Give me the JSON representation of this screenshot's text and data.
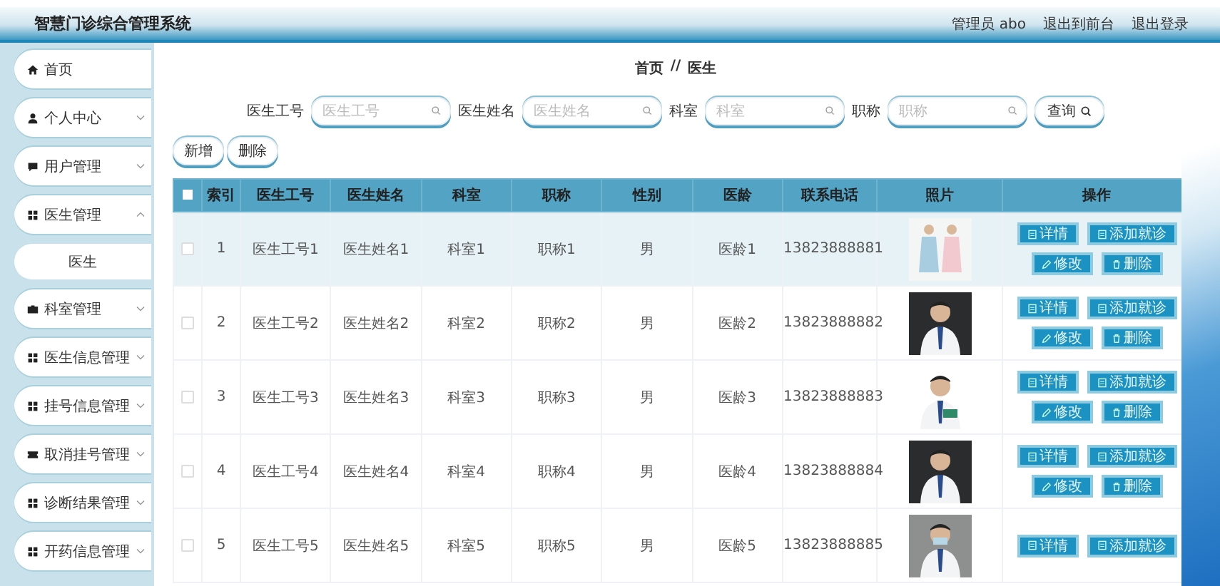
{
  "header": {
    "title": "智慧门诊综合管理系统",
    "user": "管理员 abo",
    "links": [
      "退出到前台",
      "退出登录"
    ]
  },
  "sidebar": {
    "items": [
      {
        "label": "首页"
      },
      {
        "label": "个人中心",
        "expanded": false
      },
      {
        "label": "用户管理",
        "expanded": false
      },
      {
        "label": "医生管理",
        "expanded": true,
        "children": [
          {
            "label": "医生",
            "selected": true
          }
        ]
      },
      {
        "label": "科室管理",
        "expanded": false
      },
      {
        "label": "医生信息管理",
        "expanded": false
      },
      {
        "label": "挂号信息管理",
        "expanded": false
      },
      {
        "label": "取消挂号管理",
        "expanded": false
      },
      {
        "label": "诊断结果管理",
        "expanded": false
      },
      {
        "label": "开药信息管理",
        "expanded": false
      }
    ]
  },
  "breadcrumb": [
    "首页",
    "//",
    "医生"
  ],
  "search": {
    "fields": [
      {
        "label": "医生工号",
        "placeholder": "医生工号"
      },
      {
        "label": "医生姓名",
        "placeholder": "医生姓名"
      },
      {
        "label": "科室",
        "placeholder": "科室"
      },
      {
        "label": "职称",
        "placeholder": "职称"
      }
    ],
    "button": "查询"
  },
  "actions": [
    "新增",
    "删除"
  ],
  "table": {
    "all_checked": false,
    "columns": [
      "索引",
      "医生工号",
      "医生姓名",
      "科室",
      "职称",
      "性别",
      "医龄",
      "联系电话",
      "照片",
      "操作"
    ],
    "rows": [
      {
        "cells": [
          "1",
          "医生工号1",
          "医生姓名1",
          "科室1",
          "职称1",
          "男",
          "医龄1",
          "13823888881"
        ],
        "checked": false,
        "hovered": true,
        "buttons": [
          "详情",
          "添加就诊",
          "修改",
          "删除"
        ]
      },
      {
        "cells": [
          "2",
          "医生工号2",
          "医生姓名2",
          "科室2",
          "职称2",
          "男",
          "医龄2",
          "13823888882"
        ],
        "checked": false,
        "hovered": false,
        "buttons": [
          "详情",
          "添加就诊",
          "修改",
          "删除"
        ]
      },
      {
        "cells": [
          "3",
          "医生工号3",
          "医生姓名3",
          "科室3",
          "职称3",
          "男",
          "医龄3",
          "13823888883"
        ],
        "checked": false,
        "hovered": false,
        "buttons": [
          "详情",
          "添加就诊",
          "修改",
          "删除"
        ]
      },
      {
        "cells": [
          "4",
          "医生工号4",
          "医生姓名4",
          "科室4",
          "职称4",
          "男",
          "医龄4",
          "13823888884"
        ],
        "checked": false,
        "hovered": false,
        "buttons": [
          "详情",
          "添加就诊",
          "修改",
          "删除"
        ]
      },
      {
        "cells": [
          "5",
          "医生工号5",
          "医生姓名5",
          "科室5",
          "职称5",
          "男",
          "医龄5",
          "13823888885"
        ],
        "checked": false,
        "hovered": false,
        "buttons": [
          "详情",
          "添加就诊"
        ]
      }
    ]
  }
}
